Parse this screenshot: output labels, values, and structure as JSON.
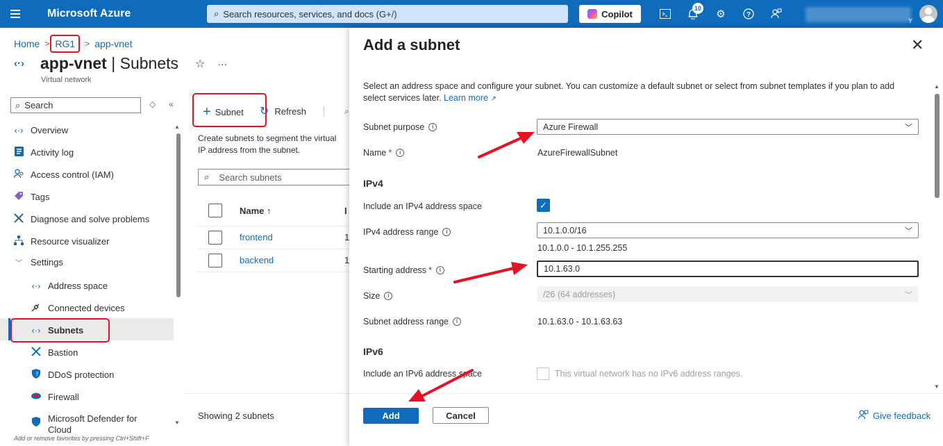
{
  "topbar": {
    "brand": "Microsoft Azure",
    "search_placeholder": "Search resources, services, and docs (G+/)",
    "copilot_label": "Copilot",
    "notification_count": "10",
    "user_suffix": "Y",
    "icons": [
      "hamburger-icon",
      "search-icon",
      "cloud-shell-icon",
      "bell-icon",
      "gear-icon",
      "help-icon",
      "feedback-icon",
      "avatar"
    ]
  },
  "breadcrumb": {
    "items": [
      "Home",
      "RG1",
      "app-vnet"
    ]
  },
  "header": {
    "name": "app-vnet",
    "separator": " | ",
    "section": "Subnets",
    "subtitle": "Virtual network",
    "star": "☆",
    "more": "···"
  },
  "nav": {
    "search_placeholder": "Search",
    "items": [
      {
        "label": "Overview",
        "icon": "vnet-icon"
      },
      {
        "label": "Activity log",
        "icon": "activity-log-icon"
      },
      {
        "label": "Access control (IAM)",
        "icon": "iam-icon"
      },
      {
        "label": "Tags",
        "icon": "tag-icon"
      },
      {
        "label": "Diagnose and solve problems",
        "icon": "wrench-icon"
      },
      {
        "label": "Resource visualizer",
        "icon": "visualizer-icon"
      },
      {
        "label": "Settings",
        "icon": "chevron-down-icon"
      },
      {
        "label": "Address space",
        "icon": "vnet-icon"
      },
      {
        "label": "Connected devices",
        "icon": "plug-icon"
      },
      {
        "label": "Subnets",
        "icon": "vnet-icon"
      },
      {
        "label": "Bastion",
        "icon": "bastion-icon"
      },
      {
        "label": "DDoS protection",
        "icon": "shield-icon"
      },
      {
        "label": "Firewall",
        "icon": "firewall-icon"
      },
      {
        "label": "Microsoft Defender for Cloud",
        "icon": "defender-icon"
      }
    ],
    "footer": "Add or remove favorites by pressing Ctrl+Shift+F"
  },
  "main": {
    "toolbar": {
      "add_subnet": "Subnet",
      "refresh": "Refresh"
    },
    "description": "Create subnets to segment the virtual network address space, IP address from the subnet.",
    "description_line1": "Create subnets to segment the virtual",
    "description_line2": "IP address from the subnet.",
    "search_placeholder": "Search subnets",
    "columns": [
      "Name ↑",
      "I"
    ],
    "rows": [
      {
        "name": "frontend",
        "ip": "1"
      },
      {
        "name": "backend",
        "ip": "1"
      }
    ],
    "footer": "Showing 2 subnets"
  },
  "panel": {
    "title": "Add a subnet",
    "description": "Select an address space and configure your subnet. You can customize a default subnet or select from subnet templates if you plan to add select services later.",
    "learn_more": "Learn more",
    "subnet_purpose_label": "Subnet purpose",
    "subnet_purpose_value": "Azure Firewall",
    "name_label": "Name",
    "name_value": "AzureFirewallSubnet",
    "ipv4_section": "IPv4",
    "include_ipv4_label": "Include an IPv4 address space",
    "ipv4_range_label": "IPv4 address range",
    "ipv4_range_value": "10.1.0.0/16",
    "ipv4_range_span": "10.1.0.0 - 10.1.255.255",
    "starting_address_label": "Starting address",
    "starting_address_value": "10.1.63.0",
    "size_label": "Size",
    "size_value": "/26 (64 addresses)",
    "subnet_range_label": "Subnet address range",
    "subnet_range_value": "10.1.63.0 - 10.1.63.63",
    "ipv6_section": "IPv6",
    "include_ipv6_label": "Include an IPv6 address space",
    "ipv6_disabled_text": "This virtual network has no IPv6 address ranges.",
    "add_button": "Add",
    "cancel_button": "Cancel",
    "feedback": "Give feedback"
  },
  "colors": {
    "azure_blue": "#0f6cbd",
    "highlight_red": "#e81123",
    "text": "#323130"
  }
}
